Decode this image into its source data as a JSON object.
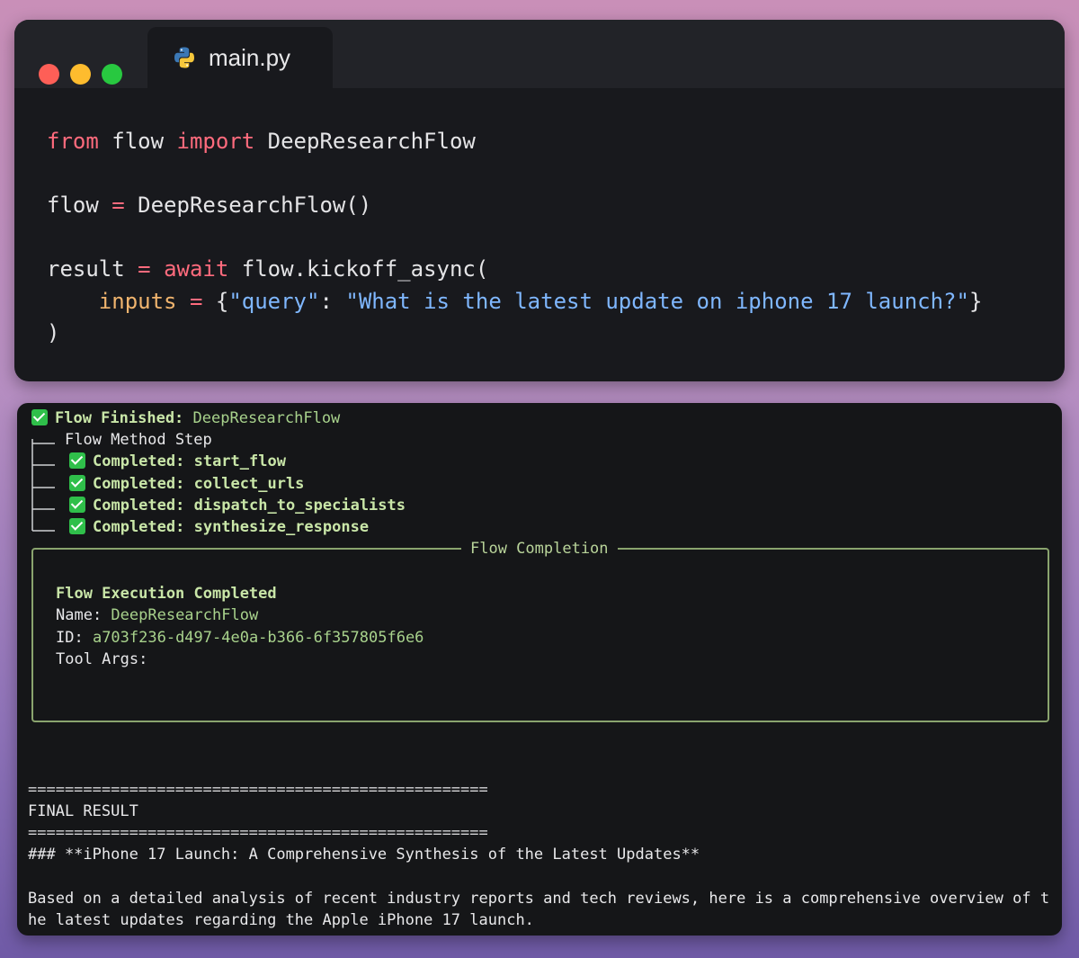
{
  "editor": {
    "tab": {
      "filename": "main.py",
      "icon": "python-icon"
    },
    "window_controls": [
      "close",
      "minimize",
      "maximize"
    ],
    "code": {
      "l1": {
        "kw1": "from",
        "mod": " flow ",
        "kw2": "import",
        "name": " DeepResearchFlow"
      },
      "l2": {
        "var": "flow ",
        "op": "=",
        "rest": " DeepResearchFlow()"
      },
      "l3": {
        "var": "result ",
        "op": "=",
        "sp": " ",
        "kw": "await",
        "rest": " flow.kickoff_async("
      },
      "l4": {
        "indent": "    ",
        "param": "inputs",
        "sp": " ",
        "op": "=",
        "open": " {",
        "key": "\"query\"",
        "colon": ": ",
        "val": "\"What is the latest update on iphone 17 launch?\"",
        "close": "}"
      },
      "l5": {
        "close": ")"
      }
    }
  },
  "terminal": {
    "finished_label": "Flow Finished:",
    "finished_value": " DeepResearchFlow",
    "method_header": "Flow Method Step",
    "steps": [
      {
        "label": "Completed:",
        "value": " start_flow"
      },
      {
        "label": "Completed:",
        "value": " collect_urls"
      },
      {
        "label": "Completed:",
        "value": " dispatch_to_specialists"
      },
      {
        "label": "Completed:",
        "value": " synthesize_response"
      }
    ],
    "panel": {
      "title": "Flow Completion",
      "heading": "Flow Execution Completed",
      "name_label": "Name:",
      "name_value": " DeepResearchFlow",
      "id_label": "ID:",
      "id_value": " a703f236-d497-4e0a-b366-6f357805f6e6",
      "tool_args_label": "Tool Args:"
    },
    "rule": "==================================================",
    "final_result": "FINAL RESULT",
    "result_heading": "### **iPhone 17 Launch: A Comprehensive Synthesis of the Latest Updates**",
    "result_line1": "Based on a detailed analysis of recent industry reports and tech reviews, here is a comprehensive overview of t",
    "result_line2": "he latest updates regarding the Apple iPhone 17 launch."
  },
  "colors": {
    "keyword": "#ff6b7d",
    "parameter": "#f0b46e",
    "string": "#7fb7ff",
    "check": "#2fbf4a",
    "terminal_green": "#c9e6a8",
    "panel_border": "#8aa46e"
  }
}
